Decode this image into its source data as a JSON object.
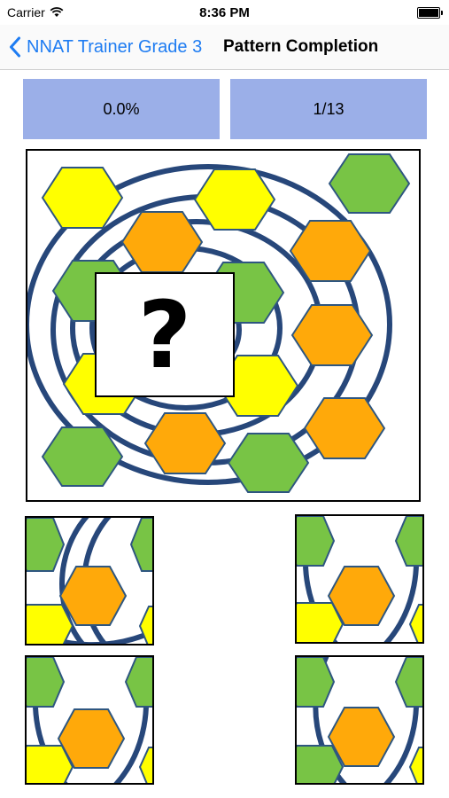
{
  "status_bar": {
    "carrier": "Carrier",
    "time": "8:36 PM"
  },
  "nav": {
    "back_label": "NNAT Trainer Grade 3",
    "title": "Pattern Completion"
  },
  "stats": {
    "score": "0.0%",
    "progress": "1/13"
  },
  "puzzle": {
    "missing_marker": "?"
  },
  "colors": {
    "yellow": "#ffff00",
    "orange": "#ffa90a",
    "green": "#78c445",
    "ring": "#27477a",
    "stat_box": "#9bafe8",
    "link": "#1e7cf2"
  },
  "answer_options": [
    {
      "id": "option-1"
    },
    {
      "id": "option-2"
    },
    {
      "id": "option-3"
    },
    {
      "id": "option-4"
    }
  ]
}
